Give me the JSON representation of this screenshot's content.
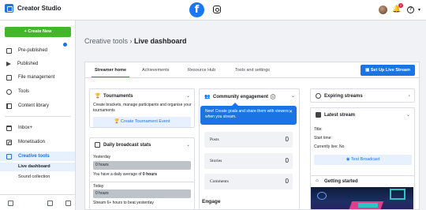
{
  "app": {
    "title": "Creator Studio",
    "notification_count": "2"
  },
  "sidebar": {
    "create_label": "Create New",
    "items": [
      {
        "label": "Pre-published",
        "icon": "document-icon"
      },
      {
        "label": "Published",
        "icon": "play-icon"
      },
      {
        "label": "File management",
        "icon": "image-icon"
      },
      {
        "label": "Tools",
        "icon": "tools-icon"
      },
      {
        "label": "Content library",
        "icon": "library-icon"
      },
      {
        "label": "Inbox+",
        "icon": "inbox-icon"
      },
      {
        "label": "Monetisation",
        "icon": "money-icon"
      },
      {
        "label": "Creative tools",
        "icon": "creative-icon"
      }
    ],
    "sub_items": [
      "Live dashboard",
      "Sound collection"
    ]
  },
  "breadcrumb": {
    "parent": "Creative tools",
    "sep": " › ",
    "current": "Live dashboard"
  },
  "tabs": [
    "Streamer home",
    "Achievements",
    "Resource Hub",
    "Tools and settings"
  ],
  "setup_button": "Set Up Live Stream",
  "tournaments": {
    "title": "Tournaments",
    "desc": "Create brackets, manage participants and organise your tournaments",
    "button": "Create Tournament Event"
  },
  "daily_stats": {
    "title": "Daily broadcast stats",
    "yesterday_label": "Yesterday",
    "yesterday_value": "0 hours",
    "average_text_pre": "You have a daily average of ",
    "average_value": "0 hours",
    "today_label": "Today",
    "today_value": "0 hours",
    "streak_text": "Stream 6+ hours to beat yesterday"
  },
  "community": {
    "title": "Community engagement",
    "tooltip": "New! Create goals and share them with viewers when you stream.",
    "metrics": [
      {
        "label": "Posts",
        "value": "0"
      },
      {
        "label": "Stories",
        "value": "0"
      },
      {
        "label": "Comments",
        "value": "0"
      }
    ],
    "engage_label": "Engage"
  },
  "expiring": {
    "title": "Expiring streams"
  },
  "latest": {
    "title": "Latest stream",
    "title_label": "Title:",
    "start_label": "Start time:",
    "live_label": "Currently live: No",
    "button": "Test Broadcast"
  },
  "getting_started": {
    "title": "Getting started"
  },
  "colors": {
    "primary": "#1b74e4",
    "create_green": "#42b72a"
  }
}
